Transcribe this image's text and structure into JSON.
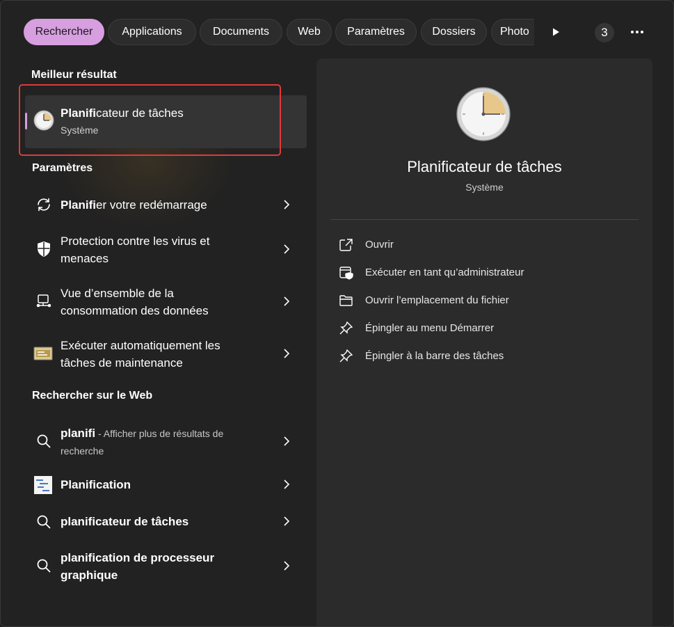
{
  "tabs": [
    {
      "label": "Rechercher",
      "active": true
    },
    {
      "label": "Applications"
    },
    {
      "label": "Documents"
    },
    {
      "label": "Web"
    },
    {
      "label": "Paramètres"
    },
    {
      "label": "Dossiers"
    },
    {
      "label": "Photo"
    }
  ],
  "badge_count": "3",
  "best_match": {
    "section_title": "Meilleur résultat",
    "title_bold": "Planifi",
    "title_rest": "cateur de tâches",
    "subtitle": "Système",
    "icon": "clock-icon"
  },
  "settings": {
    "section_title": "Paramètres",
    "items": [
      {
        "icon": "refresh-icon",
        "bold": "Planifi",
        "rest": "er votre redémarrage"
      },
      {
        "icon": "shield-icon",
        "line1": "Protection contre les virus et",
        "line2": "menaces"
      },
      {
        "icon": "monitor-network-icon",
        "line1": "Vue d’ensemble de la",
        "line2": "consommation des données"
      },
      {
        "icon": "maintenance-icon",
        "line1": "Exécuter automatiquement les",
        "line2": "tâches de maintenance"
      }
    ]
  },
  "web": {
    "section_title": "Rechercher sur le Web",
    "items": [
      {
        "icon": "search-icon",
        "bold": "planifi",
        "rest": " - Afficher plus de résultats de",
        "line2": "recherche"
      },
      {
        "icon": "gantt-icon",
        "bold": "Planification"
      },
      {
        "icon": "search-icon",
        "bold": "planificateur de tâches"
      },
      {
        "icon": "search-icon",
        "line1": "planification de processeur",
        "line2": "graphique"
      }
    ]
  },
  "detail": {
    "title": "Planificateur de tâches",
    "subtitle": "Système",
    "actions": [
      {
        "icon": "open-external-icon",
        "label": "Ouvrir"
      },
      {
        "icon": "run-as-admin-icon",
        "label": "Exécuter en tant qu’administrateur"
      },
      {
        "icon": "folder-icon",
        "label": "Ouvrir l’emplacement du fichier"
      },
      {
        "icon": "pin-icon",
        "label": "Épingler au menu Démarrer"
      },
      {
        "icon": "pin-icon",
        "label": "Épingler à la barre des tâches"
      }
    ]
  },
  "colors": {
    "accent": "#d79ee0",
    "highlight": "#e03a3a",
    "background": "#222222",
    "pane": "#2b2b2b"
  }
}
